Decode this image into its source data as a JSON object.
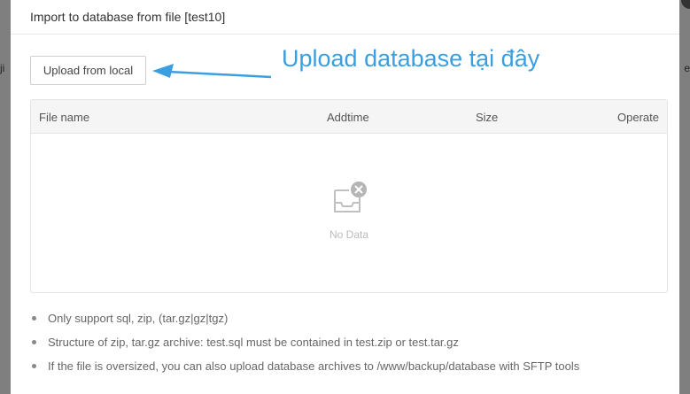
{
  "background": {
    "left_text": "ji",
    "right_text": "e"
  },
  "dialog": {
    "title": "Import to database from file [test10]"
  },
  "toolbar": {
    "upload_label": "Upload from local"
  },
  "annotation": {
    "text": "Upload database tại đây",
    "color": "#3a9fe0"
  },
  "table": {
    "columns": [
      "File name",
      "Addtime",
      "Size",
      "Operate"
    ],
    "rows": [],
    "empty_text": "No Data"
  },
  "notes": [
    "Only support sql, zip, (tar.gz|gz|tgz)",
    "Structure of zip, tar.gz archive: test.sql must be contained in test.zip or test.tar.gz",
    "If the file is oversized, you can also upload database archives to /www/backup/database with SFTP tools"
  ]
}
